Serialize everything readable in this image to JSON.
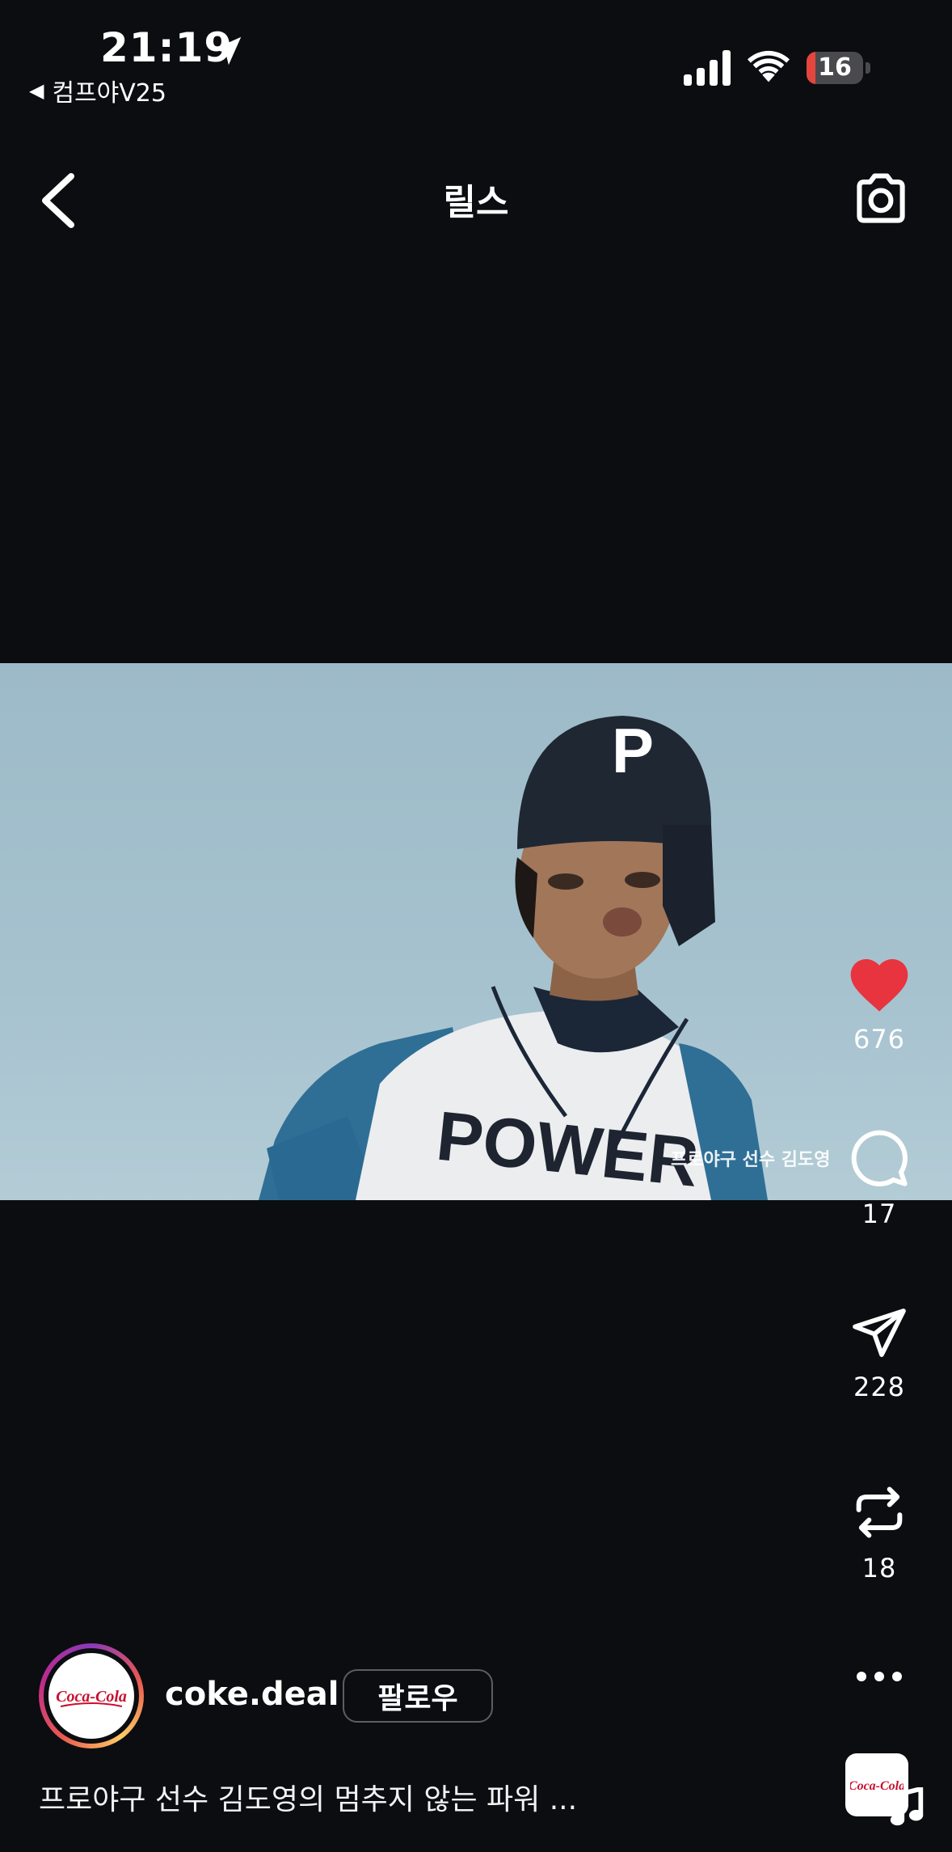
{
  "status_bar": {
    "time": "21:19",
    "back_app": "컴프야V25",
    "battery_level": "16"
  },
  "header": {
    "title": "릴스"
  },
  "video": {
    "watermark": "프로야구 선수 김도영",
    "jersey_text": "POWER",
    "helmet_letter": "P"
  },
  "actions": {
    "likes": "676",
    "comments": "17",
    "shares": "228",
    "reposts": "18"
  },
  "post": {
    "username": "coke.deal",
    "follow_label": "팔로우",
    "caption": "프로야구 선수 김도영의 멈추지 않는 파워 ...",
    "avatar_logo_text": "Coca-Cola"
  },
  "colors": {
    "background": "#0b0d11",
    "like": "#e8343f",
    "battery_low": "#e5453d"
  }
}
